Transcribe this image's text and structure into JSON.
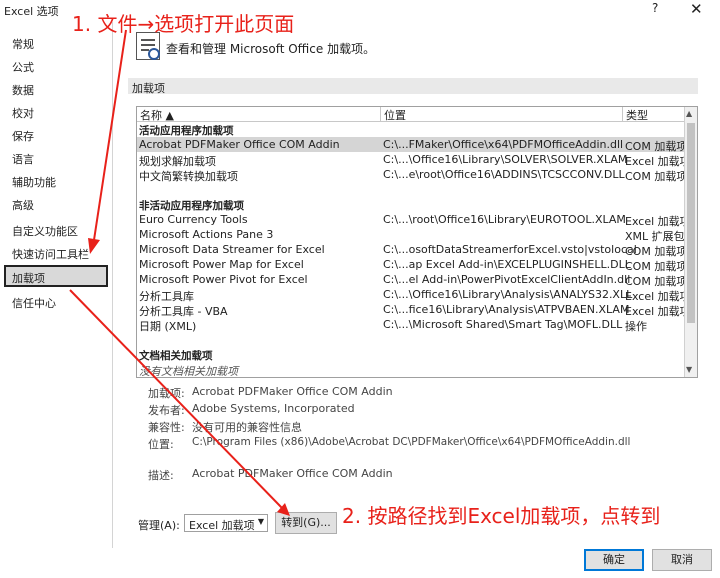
{
  "window": {
    "title": "Excel 选项",
    "help": "?",
    "close": "✕"
  },
  "sidebar": {
    "items": [
      {
        "label": "常规"
      },
      {
        "label": "公式"
      },
      {
        "label": "数据"
      },
      {
        "label": "校对"
      },
      {
        "label": "保存"
      },
      {
        "label": "语言"
      },
      {
        "label": "辅助功能"
      },
      {
        "label": "高级"
      },
      {
        "label": "自定义功能区"
      },
      {
        "label": "快速访问工具栏"
      },
      {
        "label": "加载项"
      },
      {
        "label": "信任中心"
      }
    ],
    "selected": "加载项"
  },
  "header": {
    "text": "查看和管理 Microsoft Office 加载项。",
    "icon": "addins-gear-icon"
  },
  "section": {
    "title": "加载项"
  },
  "table": {
    "columns": [
      "名称 ▲",
      "位置",
      "类型"
    ],
    "groups": [
      {
        "title": "活动应用程序加载项",
        "rows": [
          {
            "name": "Acrobat PDFMaker Office COM Addin",
            "location": "C:\\...FMaker\\Office\\x64\\PDFMOfficeAddin.dll",
            "type": "COM 加载项"
          },
          {
            "name": "规划求解加载项",
            "location": "C:\\...\\Office16\\Library\\SOLVER\\SOLVER.XLAM",
            "type": "Excel 加载项"
          },
          {
            "name": "中文简繁转换加载项",
            "location": "C:\\...e\\root\\Office16\\ADDINS\\TCSCCONV.DLL",
            "type": "COM 加载项"
          }
        ]
      },
      {
        "title": "非活动应用程序加载项",
        "rows": [
          {
            "name": "Euro Currency Tools",
            "location": "C:\\...\\root\\Office16\\Library\\EUROTOOL.XLAM",
            "type": "Excel 加载项"
          },
          {
            "name": "Microsoft Actions Pane 3",
            "location": "",
            "type": "XML 扩展包"
          },
          {
            "name": "Microsoft Data Streamer for Excel",
            "location": "C:\\...osoftDataStreamerforExcel.vsto|vstolocal",
            "type": "COM 加载项"
          },
          {
            "name": "Microsoft Power Map for Excel",
            "location": "C:\\...ap Excel Add-in\\EXCELPLUGINSHELL.DLL",
            "type": "COM 加载项"
          },
          {
            "name": "Microsoft Power Pivot for Excel",
            "location": "C:\\...el Add-in\\PowerPivotExcelClientAddIn.dll",
            "type": "COM 加载项"
          },
          {
            "name": "分析工具库",
            "location": "C:\\...\\Office16\\Library\\Analysis\\ANALYS32.XLL",
            "type": "Excel 加载项"
          },
          {
            "name": "分析工具库 - VBA",
            "location": "C:\\...fice16\\Library\\Analysis\\ATPVBAEN.XLAM",
            "type": "Excel 加载项"
          },
          {
            "name": "日期 (XML)",
            "location": "C:\\...\\Microsoft Shared\\Smart Tag\\MOFL.DLL",
            "type": "操作"
          }
        ]
      },
      {
        "title": "文档相关加载项",
        "rows": [
          {
            "name": "没有文档相关加载项",
            "location": "",
            "type": ""
          }
        ]
      }
    ]
  },
  "details": {
    "addin_label": "加载项:",
    "addin_value": "Acrobat PDFMaker Office COM Addin",
    "publisher_label": "发布者:",
    "publisher_value": "Adobe Systems, Incorporated",
    "compat_label": "兼容性:",
    "compat_value": "没有可用的兼容性信息",
    "location_label": "位置:",
    "location_value": "C:\\Program Files (x86)\\Adobe\\Acrobat DC\\PDFMaker\\Office\\x64\\PDFMOfficeAddin.dll",
    "desc_label": "描述:",
    "desc_value": "Acrobat PDFMaker Office COM Addin"
  },
  "manage": {
    "label": "管理(A):",
    "selected": "Excel 加载项",
    "go_button": "转到(G)..."
  },
  "footer": {
    "ok": "确定",
    "cancel": "取消"
  },
  "annotations": {
    "step1": "1. 文件→选项打开此页面",
    "step2": "2. 按路径找到Excel加载项，点转到",
    "color": "#e8211a"
  }
}
